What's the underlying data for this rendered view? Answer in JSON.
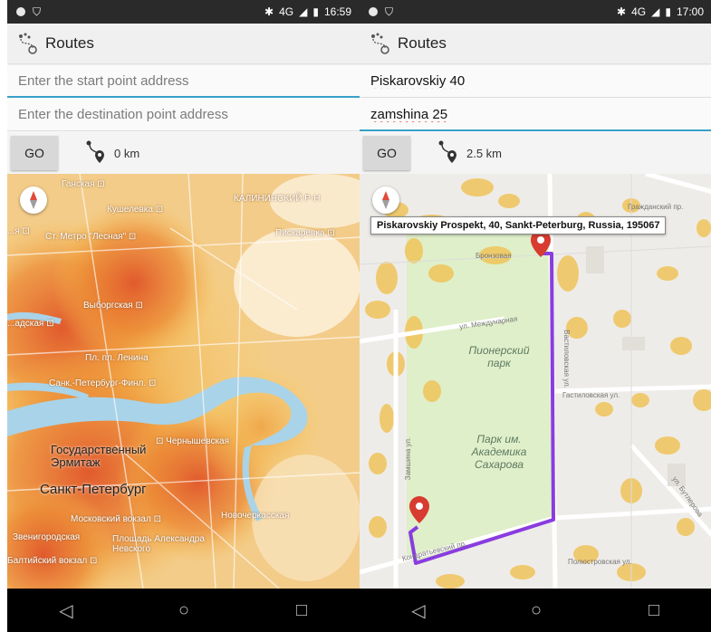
{
  "left": {
    "status": {
      "time": "16:59",
      "signal": "4G"
    },
    "app_title": "Routes",
    "start_placeholder": "Enter the start point address",
    "start_value": "",
    "dest_placeholder": "Enter the destination point address",
    "dest_value": "",
    "go_label": "GO",
    "distance": "0 km",
    "map_labels": {
      "ganskan": "Ганская ⊡",
      "kalininsky": "КАЛИНИНСКИЙ Р-Н",
      "kushelevka": "Кушелевка ⊡",
      "metro_lesnaya": "Ст. Метро \"Лесная\" ⊡",
      "piskarevka": "Пискарёвка ⊡",
      "vyborgskaya": "Выборгская ⊡",
      "ploshchad_lenina": "Пл. пл. Ленина",
      "sank_peterburg_fin": "Санк.-Петербург-Финл. ⊡",
      "chernyshevskaya": "⊡ Чернышевская",
      "hermitage": "Государственный Эрмитаж",
      "spb": "Санкт-Петербург",
      "moskovskiy": "Московский вокзал ⊡",
      "novocherkasskaya": "Новочеркасская",
      "zvenigorodskaya": "Звенигородская",
      "ploshchad_aleksandra": "Площадь Александра Невского",
      "baltiyskiy": "Балтийский вокзал ⊡",
      "left_edge_1": "...я ⊡",
      "left_edge_2": "...адская ⊡"
    }
  },
  "right": {
    "status": {
      "time": "17:00",
      "signal": "4G"
    },
    "app_title": "Routes",
    "start_value": "Piskarovskiy 40",
    "dest_value": "zamshina 25",
    "go_label": "GO",
    "distance": "2.5 km",
    "tooltip": "Piskarovskiy Prospekt, 40, Sankt-Peterburg, Russia, 195067",
    "map_labels": {
      "park_pionersky": "Пионерский парк",
      "park_sakharova": "Парк им. Академика Сахарова",
      "street_top_right": "Гражданский пр.",
      "street_bronevaya": "Бронзовая",
      "street_mezhdunarodnaya": "ул. Междунарная",
      "street_vozdukhoplavatelnaya": "Вастиловская ул.",
      "street_right_mid": "Гастиловская ул.",
      "street_bottom": "Кондратьевский пр.",
      "street_bottom_right": "Полюстровская ул.",
      "street_far_right": "ул. Бутлерова",
      "street_left_vertical": "Замшина ул."
    }
  },
  "nav": {
    "back": "◁",
    "home": "○",
    "recents": "□"
  },
  "colors": {
    "accent": "#37a0c8",
    "route": "#8a3ce0",
    "pin": "#d83b2f",
    "heat_high": "#e8662a",
    "heat_low": "#f6c84a",
    "park": "#dfefc9"
  }
}
